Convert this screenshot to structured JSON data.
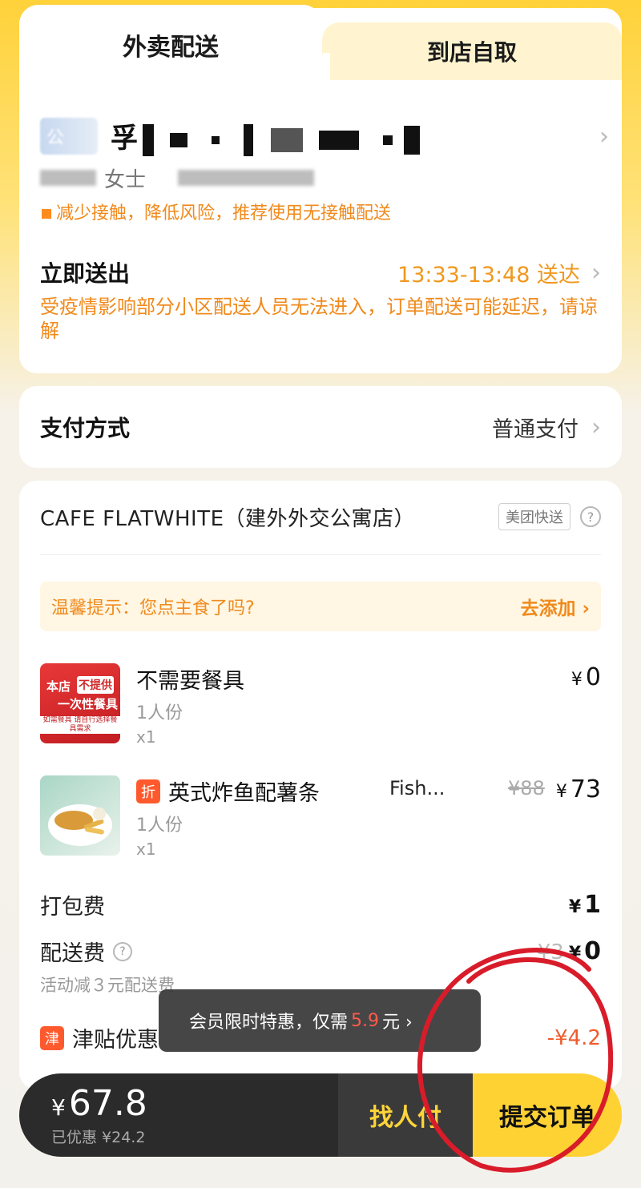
{
  "tabs": {
    "active": "外卖配送",
    "inactive": "到店自取"
  },
  "address": {
    "icon_text": "公",
    "line": "孚",
    "contact_suffix": "女士"
  },
  "safety_note": "减少接触，降低风险，推荐使用无接触配送",
  "delivery": {
    "label": "立即送出",
    "time": "13:33-13:48 送达",
    "note": "受疫情影响部分小区配送人员无法进入，订单配送可能延迟，请谅解"
  },
  "payment": {
    "label": "支付方式",
    "value": "普通支付"
  },
  "shop": {
    "name": "CAFE FLATWHITE（建外外交公寓店）",
    "badge": "美团快送",
    "help": "?"
  },
  "tip": {
    "text": "温馨提示：您点主食了吗?",
    "action": "去添加 ›"
  },
  "items": [
    {
      "name": "不需要餐具",
      "portion": "1人份",
      "qty": "x1",
      "price": "0",
      "thumb_text": {
        "a": "本店",
        "b": "不提供",
        "c": "一次性餐具",
        "d": "如需餐具 请自行选择餐具需求"
      }
    },
    {
      "tag": "折",
      "name": "英式炸鱼配薯条",
      "extra": "Fish...",
      "old_price": "¥88",
      "portion": "1人份",
      "qty": "x1",
      "price": "73"
    }
  ],
  "fees": {
    "packing": {
      "label": "打包费",
      "value": "1"
    },
    "delivery": {
      "label": "配送费",
      "old": "¥3",
      "value": "0",
      "sub": "活动减３元配送费"
    },
    "subsidy": {
      "tag": "津",
      "label": "津贴优惠",
      "value": "-¥4.2"
    }
  },
  "toast": {
    "prefix": "会员限时特惠，仅需",
    "amount": "5.9",
    "suffix": "元 ›"
  },
  "bottom": {
    "currency": "¥",
    "total": "67.8",
    "saved": "已优惠 ¥24.2",
    "ask_pay": "找人付",
    "submit": "提交订单"
  },
  "colors": {
    "accent": "#ffd233",
    "warning": "#f08a1c",
    "red_annotation": "#d91c2a"
  }
}
